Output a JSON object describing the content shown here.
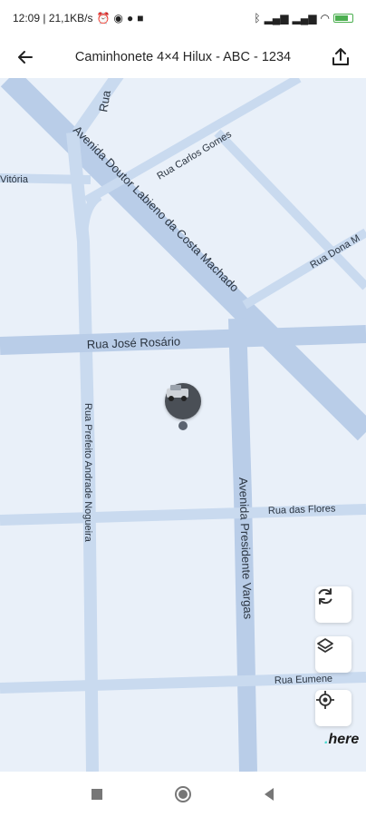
{
  "status_bar": {
    "time_net": "12:09 | 21,1KB/s",
    "icons_left": [
      "alarm-icon",
      "whatsapp-icon",
      "app-icon",
      "app-icon-2"
    ],
    "icons_right": [
      "bluetooth-icon",
      "signal-icon",
      "signal-icon-2",
      "wifi-icon",
      "battery-icon"
    ]
  },
  "header": {
    "title": "Caminhonete 4×4 Hilux - ABC - 1234"
  },
  "map": {
    "streets": {
      "rua_top": "Rua",
      "avenida_labieno": "Avenida Doutor Labieno da Costa Machado",
      "rua_carlos_gomes": "Rua Carlos Gomes",
      "vitoria": "Vitória",
      "rua_dona": "Rua Dona M",
      "rua_jose_rosario": "Rua José Rosário",
      "rua_prefeito": "Rua Prefeito Andrade Nogueira",
      "avenida_presidente": "Avenida Presidente Vargas",
      "rua_flores": "Rua das Flores",
      "rua_eumene": "Rua Eumene"
    },
    "colors": {
      "background": "#e9f0f9",
      "road": "#c9daef",
      "road_major": "#b9cde8"
    },
    "logo": "here"
  },
  "controls": {
    "refresh": "refresh-icon",
    "layers": "layers-icon",
    "locate": "locate-icon"
  },
  "nav": [
    "recents-button",
    "home-button",
    "back-button"
  ]
}
